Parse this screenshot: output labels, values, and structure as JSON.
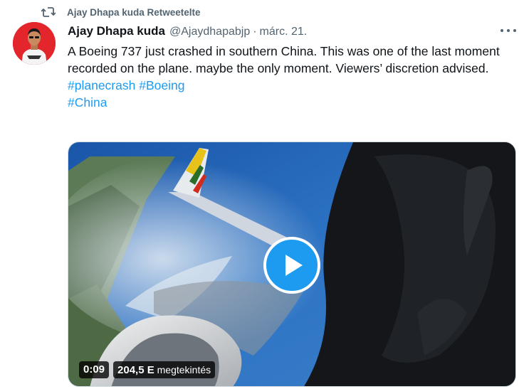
{
  "retweet": {
    "icon": "retweet-icon",
    "text": "Ajay Dhapa kuda Retweetelte"
  },
  "tweet": {
    "author": {
      "name": "Ajay Dhapa kuda",
      "handle": "@Ajaydhapabjp",
      "avatar": "avatar"
    },
    "separator": "·",
    "time": "márc. 21.",
    "more_icon": "more-options-icon",
    "text": "A Boeing 737 just crashed in southern China. This was one of the last moment recorded on the plane. maybe the only moment. Viewers’ discretion advised.",
    "hashtags": [
      "#planecrash",
      "#Boeing",
      "#China"
    ],
    "media": {
      "type": "video",
      "play_icon": "play-icon",
      "duration": "0:09",
      "views_count": "204,5 E",
      "views_label": "megtekintés"
    }
  },
  "colors": {
    "accent": "#1d9bf0",
    "text": "#0f1419",
    "secondary": "#536471",
    "avatar_bg": "#e2262b"
  }
}
